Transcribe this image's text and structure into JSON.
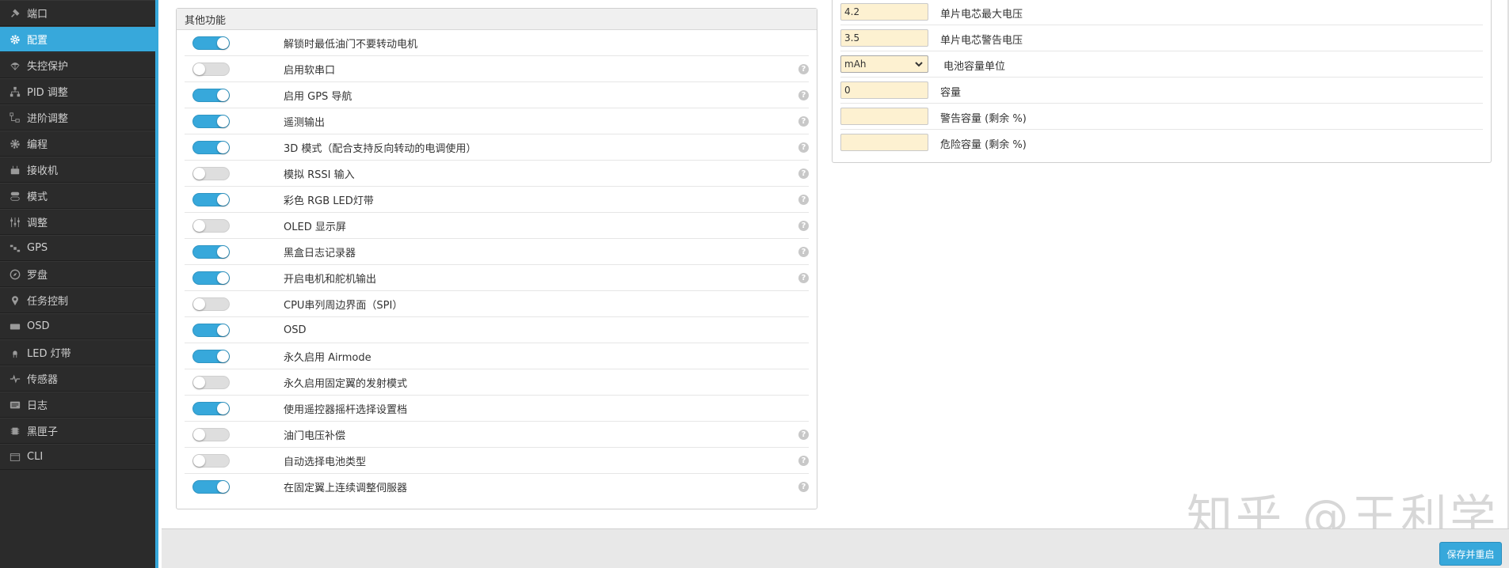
{
  "sidebar": {
    "items": [
      {
        "label": "端口",
        "icon": "plug-icon"
      },
      {
        "label": "配置",
        "icon": "gear-icon",
        "active": true
      },
      {
        "label": "失控保护",
        "icon": "parachute-icon"
      },
      {
        "label": "PID 调整",
        "icon": "sitemap-icon"
      },
      {
        "label": "进阶调整",
        "icon": "tree-icon"
      },
      {
        "label": "编程",
        "icon": "cog-icon"
      },
      {
        "label": "接收机",
        "icon": "receiver-icon"
      },
      {
        "label": "模式",
        "icon": "toggles-icon"
      },
      {
        "label": "调整",
        "icon": "sliders-icon"
      },
      {
        "label": "GPS",
        "icon": "satellite-icon"
      },
      {
        "label": "罗盘",
        "icon": "compass-icon"
      },
      {
        "label": "任务控制",
        "icon": "map-marker-icon"
      },
      {
        "label": "OSD",
        "icon": "osd-icon"
      },
      {
        "label": "LED 灯带",
        "icon": "led-icon"
      },
      {
        "label": "传感器",
        "icon": "pulse-icon"
      },
      {
        "label": "日志",
        "icon": "log-icon"
      },
      {
        "label": "黑匣子",
        "icon": "chip-icon"
      },
      {
        "label": "CLI",
        "icon": "terminal-icon"
      }
    ]
  },
  "features": {
    "title": "其他功能",
    "items": [
      {
        "label": "解锁时最低油门不要转动电机",
        "on": true,
        "help": false
      },
      {
        "label": "启用软串口",
        "on": false,
        "help": true
      },
      {
        "label": "启用 GPS 导航",
        "on": true,
        "help": true
      },
      {
        "label": "遥测输出",
        "on": true,
        "help": true
      },
      {
        "label": "3D 模式（配合支持反向转动的电调使用）",
        "on": true,
        "help": true
      },
      {
        "label": "模拟 RSSI 输入",
        "on": false,
        "help": true
      },
      {
        "label": "彩色 RGB LED灯带",
        "on": true,
        "help": true
      },
      {
        "label": "OLED 显示屏",
        "on": false,
        "help": true
      },
      {
        "label": "黑盒日志记录器",
        "on": true,
        "help": true
      },
      {
        "label": "开启电机和舵机输出",
        "on": true,
        "help": true
      },
      {
        "label": "CPU串列周边界面（SPI）",
        "on": false,
        "help": false
      },
      {
        "label": "OSD",
        "on": true,
        "help": false
      },
      {
        "label": "永久启用 Airmode",
        "on": true,
        "help": false
      },
      {
        "label": "永久启用固定翼的发射模式",
        "on": false,
        "help": false
      },
      {
        "label": "使用遥控器摇杆选择设置档",
        "on": true,
        "help": false
      },
      {
        "label": "油门电压补偿",
        "on": false,
        "help": true
      },
      {
        "label": "自动选择电池类型",
        "on": false,
        "help": true
      },
      {
        "label": "在固定翼上连续调整伺服器",
        "on": true,
        "help": true
      }
    ]
  },
  "battery": {
    "rows": [
      {
        "kind": "input",
        "value": "4.2",
        "label": "单片电芯最大电压"
      },
      {
        "kind": "input",
        "value": "3.5",
        "label": "单片电芯警告电压"
      },
      {
        "kind": "select",
        "value": "mAh",
        "label": "电池容量单位"
      },
      {
        "kind": "input",
        "value": "0",
        "label": "容量"
      },
      {
        "kind": "input",
        "value": "",
        "label": "警告容量 (剩余 %)"
      },
      {
        "kind": "input",
        "value": "",
        "label": "危险容量 (剩余 %)"
      }
    ]
  },
  "footer": {
    "save_label": "保存并重启"
  },
  "watermark": "知乎 @王利学",
  "colors": {
    "accent": "#37a8db",
    "sidebar_bg": "#2b2b2b",
    "input_bg": "#fdf1d1"
  }
}
